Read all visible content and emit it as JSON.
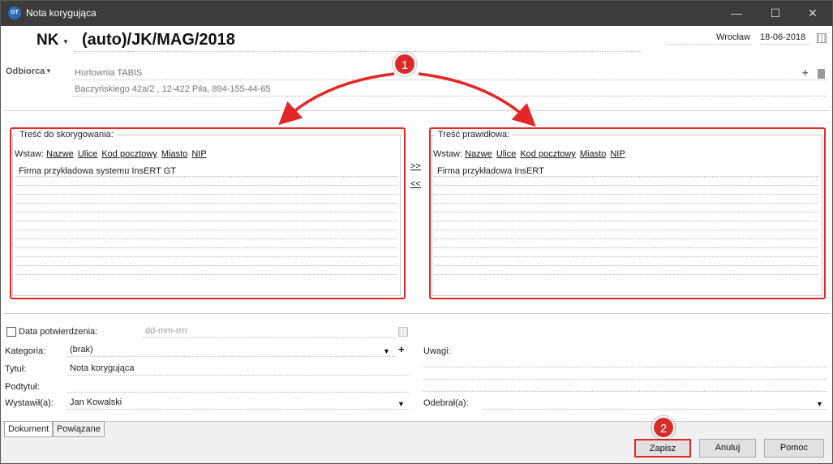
{
  "window": {
    "title": "Nota korygująca",
    "logo_text": "GT"
  },
  "header": {
    "doc_type": "NK",
    "doc_number": "(auto)/JK/MAG/2018",
    "city": "Wrocław",
    "date": "18-06-2018"
  },
  "recipient": {
    "label": "Odbiorca",
    "name": "Hurtownia TABIS",
    "address": "Baczyńskiego  42a/2 , 12-422 Piła, 894-155-44-65"
  },
  "left_panel": {
    "title": "Treść do skorygowania:",
    "insert_label": "Wstaw:",
    "links": [
      "Nazwe",
      "Ulice",
      "Kod pocztowy",
      "Miasto",
      "NIP"
    ],
    "text": "Firma przykładowa systemu InsERT GT"
  },
  "right_panel": {
    "title": "Treść prawidłowa:",
    "insert_label": "Wstaw:",
    "links": [
      "Nazwe",
      "Ulice",
      "Kod pocztowy",
      "Miasto",
      "NIP"
    ],
    "text": "Firma przykładowa InsERT"
  },
  "transfer": {
    "right": ">>",
    "left": "<<"
  },
  "form": {
    "confirm_date_label": "Data potwierdzenia:",
    "confirm_date_placeholder": "dd-mm-rrrr",
    "category_label": "Kategoria:",
    "category_value": "(brak)",
    "title_label": "Tytuł:",
    "title_value": "Nota korygująca",
    "subtitle_label": "Podtytuł:",
    "subtitle_value": "",
    "issued_label": "Wystawił(a):",
    "issued_value": "Jan Kowalski",
    "notes_label": "Uwagi:",
    "received_label": "Odebrał(a):",
    "received_value": ""
  },
  "tabs": [
    "Dokument",
    "Powiązane"
  ],
  "buttons": {
    "save": "Zapisz",
    "cancel": "Anuluj",
    "help": "Pomoc"
  },
  "annotations": {
    "badge1": "1",
    "badge2": "2",
    "color": "#e32626"
  }
}
